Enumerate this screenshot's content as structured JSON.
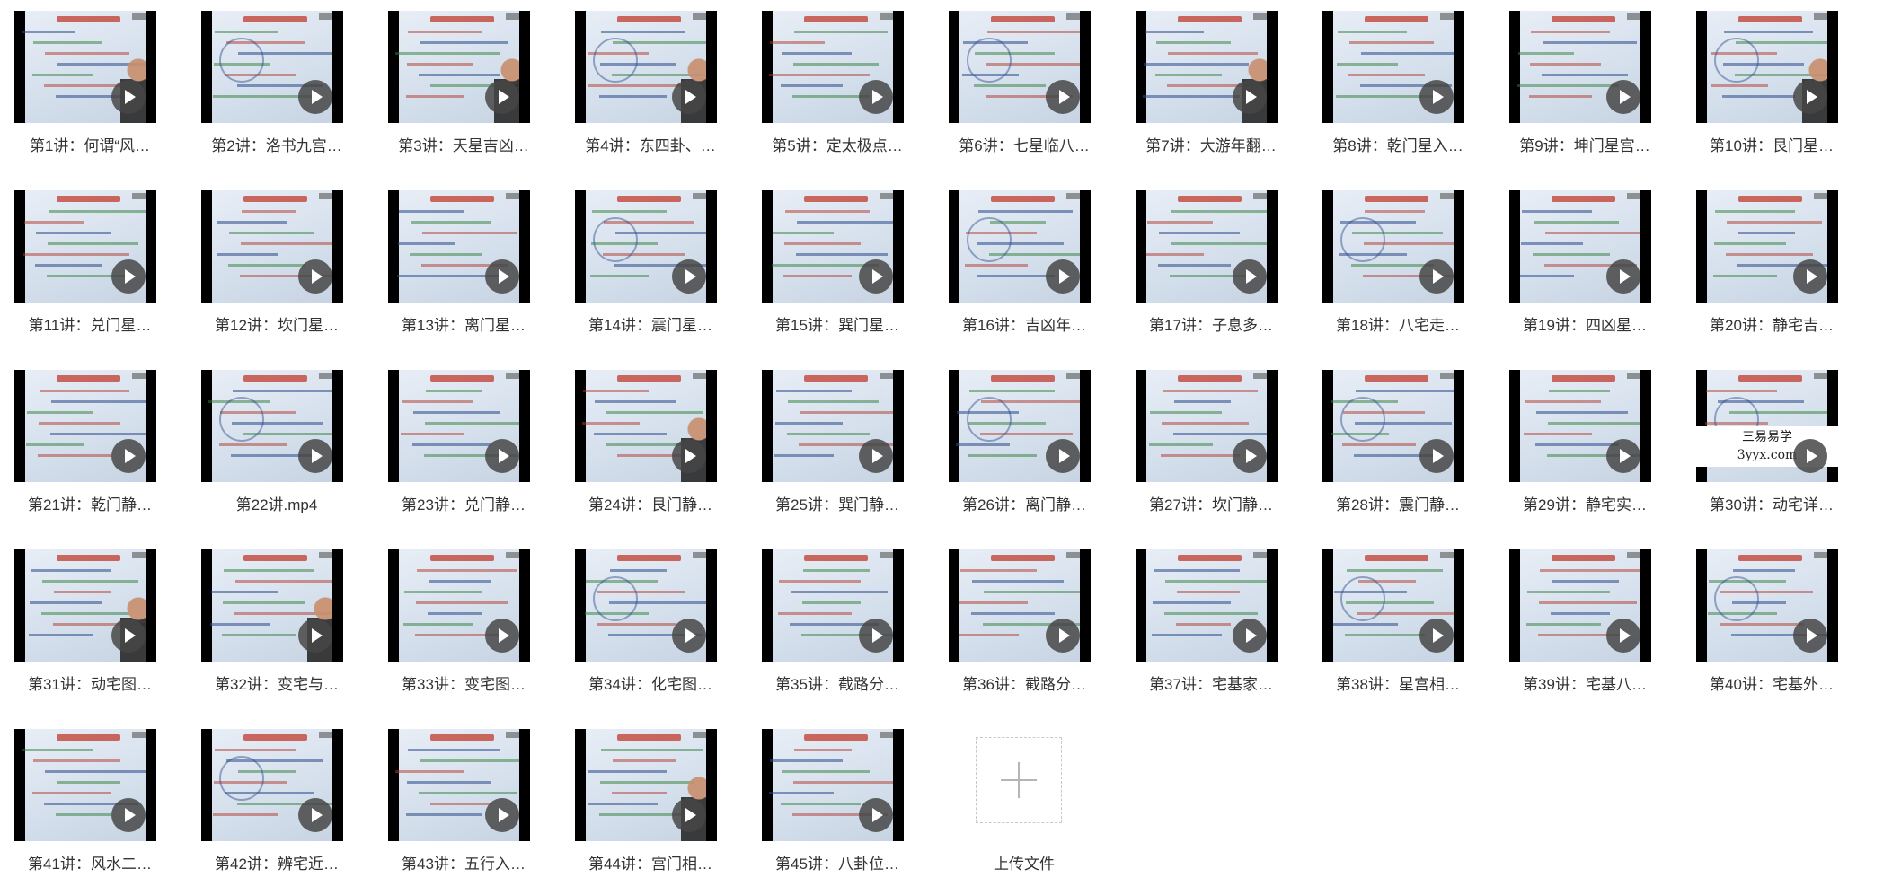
{
  "files": [
    {
      "label": "第1讲：何谓“风…"
    },
    {
      "label": "第2讲：洛书九宫…"
    },
    {
      "label": "第3讲：天星吉凶…"
    },
    {
      "label": "第4讲：东四卦、…"
    },
    {
      "label": "第5讲：定太极点…"
    },
    {
      "label": "第6讲：七星临八…"
    },
    {
      "label": "第7讲：大游年翻…"
    },
    {
      "label": "第8讲：乾门星入…"
    },
    {
      "label": "第9讲：坤门星宫…"
    },
    {
      "label": "第10讲：艮门星…"
    },
    {
      "label": "第11讲：兑门星…"
    },
    {
      "label": "第12讲：坎门星…"
    },
    {
      "label": "第13讲：离门星…"
    },
    {
      "label": "第14讲：震门星…"
    },
    {
      "label": "第15讲：巽门星…"
    },
    {
      "label": "第16讲：吉凶年…"
    },
    {
      "label": "第17讲：子息多…"
    },
    {
      "label": "第18讲：八宅走…"
    },
    {
      "label": "第19讲：四凶星…"
    },
    {
      "label": "第20讲：静宅吉…"
    },
    {
      "label": "第21讲：乾门静…"
    },
    {
      "label": "第22讲.mp4"
    },
    {
      "label": "第23讲：兑门静…"
    },
    {
      "label": "第24讲：艮门静…"
    },
    {
      "label": "第25讲：巽门静…"
    },
    {
      "label": "第26讲：离门静…"
    },
    {
      "label": "第27讲：坎门静…"
    },
    {
      "label": "第28讲：震门静…"
    },
    {
      "label": "第29讲：静宅实…"
    },
    {
      "label": "第30讲：动宅详…"
    },
    {
      "label": "第31讲：动宅图…"
    },
    {
      "label": "第32讲：变宅与…"
    },
    {
      "label": "第33讲：变宅图…"
    },
    {
      "label": "第34讲：化宅图…"
    },
    {
      "label": "第35讲：截路分…"
    },
    {
      "label": "第36讲：截路分…"
    },
    {
      "label": "第37讲：宅基家…"
    },
    {
      "label": "第38讲：星宫相…"
    },
    {
      "label": "第39讲：宅基八…"
    },
    {
      "label": "第40讲：宅基外…"
    },
    {
      "label": "第41讲：风水二…"
    },
    {
      "label": "第42讲：辨宅近…"
    },
    {
      "label": "第43讲：五行入…"
    },
    {
      "label": "第44讲：宫门相…"
    },
    {
      "label": "第45讲：八卦位…"
    }
  ],
  "watermark": {
    "line1": "三易易学",
    "line2": "3yyx.com"
  },
  "upload": {
    "label": "上传文件"
  },
  "colors": {
    "label_text": "#333333",
    "play_button": "#464646",
    "screen_bg": "#dfe7f1"
  }
}
